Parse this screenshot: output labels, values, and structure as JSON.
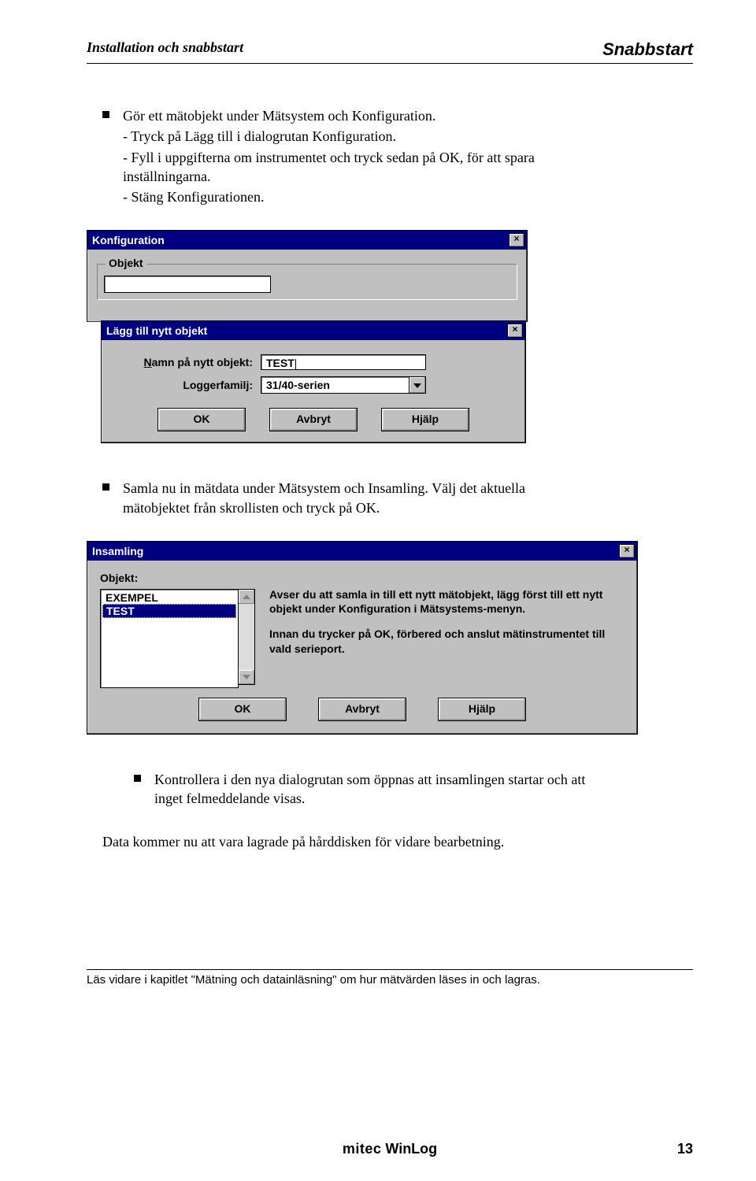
{
  "header": {
    "left": "Installation och snabbstart",
    "right": "Snabbstart"
  },
  "bullets": {
    "b1": "Gör ett mätobjekt under Mätsystem och Konfiguration.",
    "b1_sub1": "- Tryck på Lägg till i dialogrutan Konfiguration.",
    "b1_sub2": "- Fyll i uppgifterna om instrumentet och tryck sedan på OK, för att spara inställningarna.",
    "b1_sub3": "- Stäng Konfigurationen.",
    "b2": "Samla nu in mätdata under Mätsystem och Insamling. Välj det aktuella mätobjektet från skrollisten och  tryck på OK.",
    "b3": "Kontrollera i den nya dialogrutan som öppnas att insamlingen startar och att inget felmeddelande visas.",
    "after": "Data kommer nu att vara lagrade på hårddisken för vidare bearbetning."
  },
  "dialog_konfig": {
    "title": "Konfiguration",
    "group": "Objekt"
  },
  "dialog_add": {
    "title": "Lägg till nytt objekt",
    "name_label_pre": "N",
    "name_label_rest": "amn på nytt objekt:",
    "name_value": "TEST",
    "family_label": "Loggerfamilj:",
    "family_value": "31/40-serien",
    "btn_ok": "OK",
    "btn_cancel": "Avbryt",
    "btn_help": "Hjälp"
  },
  "dialog_insamling": {
    "title": "Insamling",
    "objekt_label": "Objekt:",
    "list_items": [
      "EXEMPEL",
      "TEST"
    ],
    "info1": "Avser du att samla in till ett nytt mätobjekt, lägg först till ett nytt objekt under Konfiguration i Mätsystems-menyn.",
    "info2": "Innan du trycker på OK, förbered och anslut mätinstrumentet till vald serieport.",
    "btn_ok": "OK",
    "btn_cancel": "Avbryt",
    "btn_help": "Hjälp"
  },
  "bottom_note": "Läs vidare i kapitlet \"Mätning och datainläsning\" om hur mätvärden läses in och lagras.",
  "footer": {
    "brand_left": "mitec",
    "brand_right": "WinLog",
    "page": "13"
  }
}
